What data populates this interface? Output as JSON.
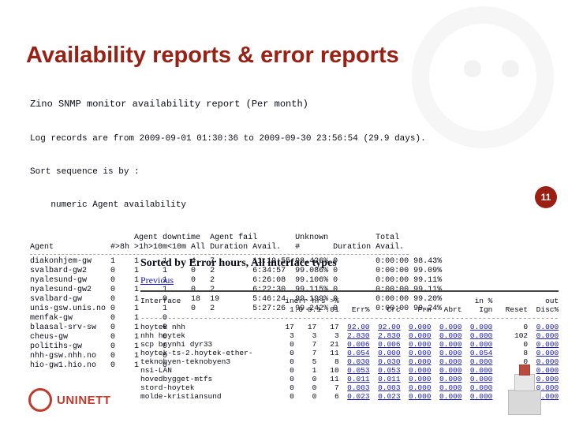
{
  "title": "Availability reports & error reports",
  "page_number": "11",
  "logo_text": "UNINETT",
  "report1": {
    "header": "Zino SNMP monitor availability report (Per month)",
    "meta1": "Log records are from 2009-09-01 01:30:36 to 2009-09-30 23:56:54 (29.9 days).",
    "meta2": "Sort sequence is by :",
    "meta3": "    numeric Agent availability",
    "col_group1": "Agent downtime",
    "col_group2": "Agent fail",
    "col_group3": "Unknown",
    "col_group4": "Total",
    "col_agent": "Agent",
    "col_h1": "#>8h",
    "col_h2": ">1h>10m<10m",
    "col_h3": "All",
    "col_h4": "Duration",
    "col_h5": "Avail.",
    "col_h6": "#",
    "col_h7": "Duration",
    "col_h8": "Avail.",
    "rows": [
      {
        "a": "diakonhjem-gw",
        "c1": "1",
        "c2": "1",
        "c3": "1",
        "c4": "4",
        "c5": "7",
        "dur": "11:19:55",
        "av": "98.426%",
        "u": "0",
        "ud": "0:00:00",
        "tot": "98.43%"
      },
      {
        "a": "svalbard-gw2",
        "c1": "0",
        "c2": "1",
        "c3": "1",
        "c4": "0",
        "c5": "2",
        "dur": "6:34:57",
        "av": "99.086%",
        "u": "0",
        "ud": "0:00:00",
        "tot": "99.09%"
      },
      {
        "a": "nyalesund-gw",
        "c1": "0",
        "c2": "1",
        "c3": "1",
        "c4": "0",
        "c5": "2",
        "dur": "6:26:08",
        "av": "99.106%",
        "u": "0",
        "ud": "0:00:00",
        "tot": "99.11%"
      },
      {
        "a": "nyalesund-gw2",
        "c1": "0",
        "c2": "1",
        "c3": "1",
        "c4": "0",
        "c5": "2",
        "dur": "6:22:30",
        "av": "99.115%",
        "u": "0",
        "ud": "0:00:00",
        "tot": "99.11%"
      },
      {
        "a": "svalbard-gw",
        "c1": "0",
        "c2": "1",
        "c3": "0",
        "c4": "18",
        "c5": "19",
        "dur": "5:46:24",
        "av": "99.199%",
        "u": "0",
        "ud": "0:00:00",
        "tot": "99.20%"
      },
      {
        "a": "unis-gsw.unis.no",
        "c1": "0",
        "c2": "1",
        "c3": "1",
        "c4": "0",
        "c5": "2",
        "dur": "5:27:26",
        "av": "99.242%",
        "u": "0",
        "ud": "0:00:00",
        "tot": "99.24%"
      },
      {
        "a": "menfak-gw",
        "c1": "0",
        "c2": "1",
        "c3": "0",
        "c4": "",
        "c5": "",
        "dur": "",
        "av": "",
        "u": "",
        "ud": "",
        "tot": ""
      },
      {
        "a": "blaasal-srv-sw",
        "c1": "0",
        "c2": "1",
        "c3": "0",
        "c4": "",
        "c5": "",
        "dur": "",
        "av": "",
        "u": "",
        "ud": "",
        "tot": ""
      },
      {
        "a": "cheus-gw",
        "c1": "0",
        "c2": "1",
        "c3": "0",
        "c4": "",
        "c5": "",
        "dur": "",
        "av": "",
        "u": "",
        "ud": "",
        "tot": ""
      },
      {
        "a": "politihs-gw",
        "c1": "0",
        "c2": "1",
        "c3": "0",
        "c4": "",
        "c5": "",
        "dur": "",
        "av": "",
        "u": "",
        "ud": "",
        "tot": ""
      },
      {
        "a": "nhh-gsw.nhh.no",
        "c1": "0",
        "c2": "1",
        "c3": "0",
        "c4": "",
        "c5": "",
        "dur": "",
        "av": "",
        "u": "",
        "ud": "",
        "tot": ""
      },
      {
        "a": "hio-gw1.hio.no",
        "c1": "0",
        "c2": "1",
        "c3": "0",
        "c4": "",
        "c5": "",
        "dur": "",
        "av": "",
        "u": "",
        "ud": "",
        "tot": ""
      }
    ]
  },
  "report2": {
    "caption": "Sorted by Error hours, All interface types",
    "previous": "Previous",
    "col_iface": "Interface",
    "col_ie": "inerr hrs >%",
    "col_sub": "1.0  0.1  .01",
    "col_errs": "Err%",
    "col_crc": "Crc",
    "col_inpct": "in %",
    "col_frm": "Frm",
    "col_abrt": "Abrt",
    "col_ign": "Ign",
    "col_out": "out",
    "col_reset": "Reset",
    "col_disc": "Disc%",
    "rows": [
      {
        "i": "hoytek nhh",
        "a": "17",
        "b": "17",
        "c": "17",
        "e": "92.00",
        "c2": "92.00",
        "f": "0.000",
        "g": "0.000",
        "h": "0.000",
        "x": "",
        "r": "0",
        "d": "0.000"
      },
      {
        "i": "nhh hoytek",
        "a": "3",
        "b": "3",
        "c": "3",
        "e": "2.830",
        "c2": "2.830",
        "f": "0.000",
        "g": "0.000",
        "h": "0.000",
        "x": "",
        "r": "102",
        "d": "0.000"
      },
      {
        "i": "scp brynhi dyr33",
        "a": "0",
        "b": "7",
        "c": "21",
        "e": "0.006",
        "c2": "0.006",
        "f": "0.000",
        "g": "0.000",
        "h": "0.000",
        "x": "",
        "r": "0",
        "d": "0.000"
      },
      {
        "i": "hoytek-ts-2.hoytek-ether-",
        "a": "0",
        "b": "7",
        "c": "11",
        "e": "0.054",
        "c2": "0.000",
        "f": "0.000",
        "g": "0.000",
        "h": "0.054",
        "x": "",
        "r": "8",
        "d": "0.000"
      },
      {
        "i": "teknobyen-teknobyen3",
        "a": "0",
        "b": "5",
        "c": "8",
        "e": "0.030",
        "c2": "0.030",
        "f": "0.000",
        "g": "0.000",
        "h": "0.000",
        "x": "",
        "r": "0",
        "d": "0.000"
      },
      {
        "i": "nsi-LAN",
        "a": "0",
        "b": "1",
        "c": "10",
        "e": "0.053",
        "c2": "0.053",
        "f": "0.000",
        "g": "0.000",
        "h": "0.000",
        "x": "",
        "r": "0",
        "d": "0.000"
      },
      {
        "i": "hovedbygget-mtfs",
        "a": "0",
        "b": "0",
        "c": "11",
        "e": "0.011",
        "c2": "0.011",
        "f": "0.000",
        "g": "0.000",
        "h": "0.000",
        "x": "",
        "r": "0",
        "d": "0.000"
      },
      {
        "i": "stord-hoytek",
        "a": "0",
        "b": "0",
        "c": "7",
        "e": "0.003",
        "c2": "0.003",
        "f": "0.000",
        "g": "0.000",
        "h": "0.000",
        "x": "",
        "r": "0",
        "d": "0.000"
      },
      {
        "i": "molde-kristiansund",
        "a": "0",
        "b": "0",
        "c": "6",
        "e": "0.023",
        "c2": "0.023",
        "f": "0.000",
        "g": "0.000",
        "h": "0.000",
        "x": "",
        "r": "0",
        "d": "0.000"
      }
    ]
  }
}
